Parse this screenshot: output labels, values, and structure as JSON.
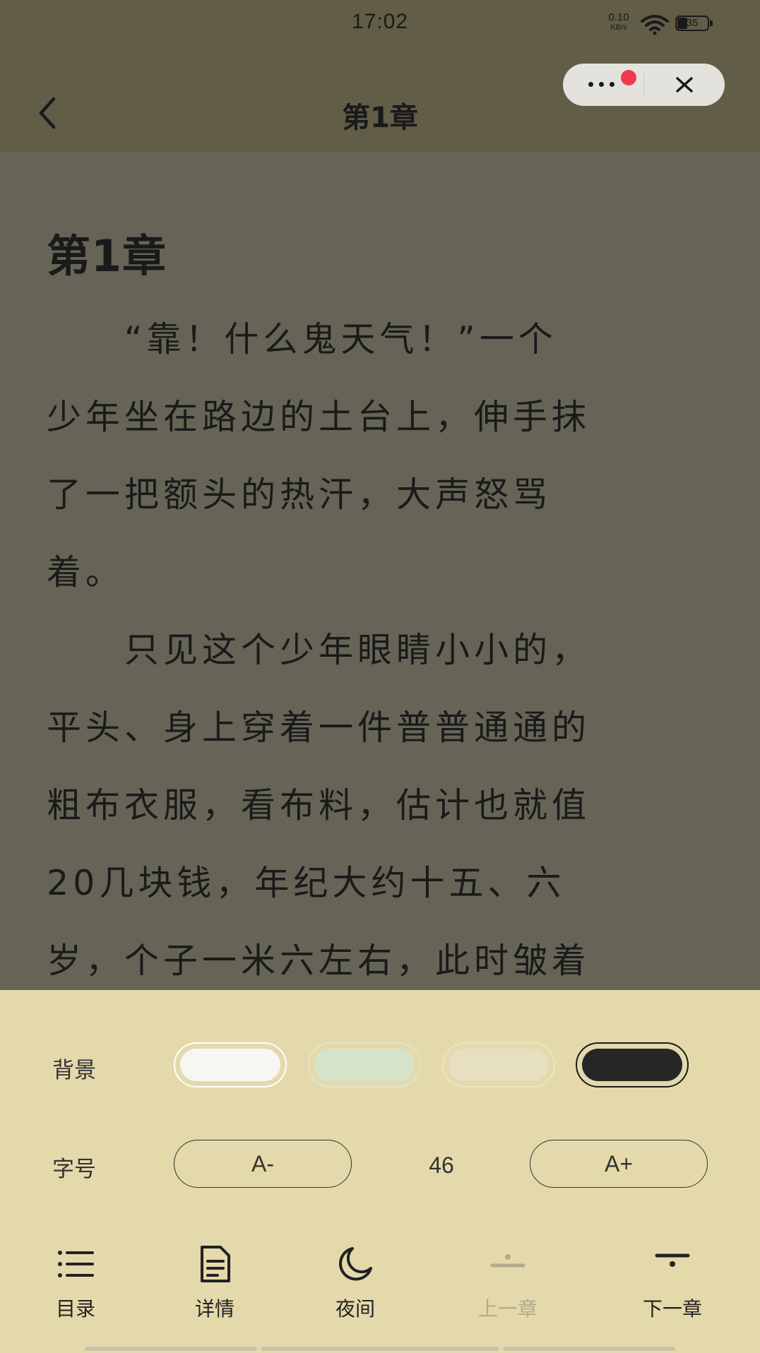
{
  "status_bar": {
    "time": "17:02",
    "net_speed_value": "0.10",
    "net_speed_unit": "KB/s",
    "battery_level": "35",
    "icons": [
      "wifi-icon",
      "battery-icon"
    ]
  },
  "nav": {
    "title": "第1章",
    "icons": [
      "chevron-left-icon",
      "more-dots-icon",
      "close-icon"
    ]
  },
  "content": {
    "chapter_heading": "第1章",
    "lines": [
      "　　“靠！什么鬼天气！”一个",
      "少年坐在路边的土台上，伸手抹",
      "了一把额头的热汗，大声怒骂",
      "着。",
      "　　只见这个少年眼睛小小的，",
      "平头、身上穿着一件普普通通的",
      "粗布衣服，看布料，估计也就值",
      "20几块钱，年纪大约十五、六",
      "岁，个子一米六左右，此时皱着"
    ]
  },
  "settings": {
    "background_label": "背景",
    "background_options": [
      {
        "name": "white",
        "color": "#f7f6f3"
      },
      {
        "name": "green",
        "color": "#d5e4c8"
      },
      {
        "name": "beige",
        "color": "#e6e0c0"
      },
      {
        "name": "black",
        "color": "#262626"
      }
    ],
    "selected_background": "black",
    "font_size_label": "字号",
    "decrease_label": "A-",
    "increase_label": "A+",
    "font_size_value": "46"
  },
  "toolbar": {
    "items": [
      {
        "label": "目录",
        "icon": "list-icon",
        "enabled": true
      },
      {
        "label": "详情",
        "icon": "document-icon",
        "enabled": true
      },
      {
        "label": "夜间",
        "icon": "moon-icon",
        "enabled": true
      },
      {
        "label": "上一章",
        "icon": "previous-chapter-icon",
        "enabled": false
      },
      {
        "label": "下一章",
        "icon": "next-chapter-icon",
        "enabled": true
      }
    ]
  },
  "colors": {
    "reading_background": "#656456",
    "header_background": "#625d47",
    "panel_background": "#e4d9ab",
    "notification_dot": "#f03a4b"
  }
}
